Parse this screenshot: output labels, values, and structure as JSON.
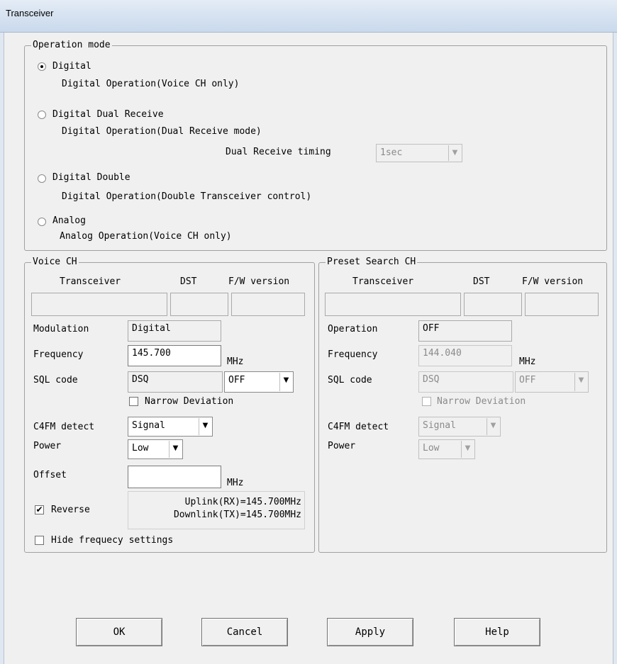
{
  "window": {
    "title": "Transceiver"
  },
  "operation_mode": {
    "group_label": "Operation mode",
    "digital": {
      "label": "Digital",
      "desc": "Digital Operation(Voice CH only)",
      "selected": true
    },
    "dual_receive": {
      "label": "Digital Dual Receive",
      "desc": "Digital Operation(Dual Receive mode)",
      "timing_label": "Dual Receive timing",
      "timing_value": "1sec",
      "selected": false
    },
    "double": {
      "label": "Digital Double",
      "desc": "Digital Operation(Double Transceiver control)",
      "selected": false
    },
    "analog": {
      "label": "Analog",
      "desc": "Analog Operation(Voice CH only)",
      "selected": false
    }
  },
  "voice_ch": {
    "group_label": "Voice CH",
    "col_transceiver": "Transceiver",
    "col_dst": "DST",
    "col_fw": "F/W version",
    "transceiver_value": "",
    "dst_value": "",
    "fw_value": "",
    "modulation_label": "Modulation",
    "modulation_value": "Digital",
    "frequency_label": "Frequency",
    "frequency_value": "145.700",
    "frequency_unit": "MHz",
    "sql_label": "SQL code",
    "sql_code_value": "DSQ",
    "sql_select_value": "OFF",
    "narrow_label": "Narrow Deviation",
    "narrow_checked": false,
    "c4fm_label": "C4FM detect",
    "c4fm_value": "Signal",
    "power_label": "Power",
    "power_value": "Low",
    "offset_label": "Offset",
    "offset_value": "",
    "offset_unit": "MHz",
    "reverse_label": "Reverse",
    "reverse_checked": true,
    "uplink": "Uplink(RX)=145.700MHz",
    "downlink": "Downlink(TX)=145.700MHz",
    "hide_label": "Hide frequecy settings",
    "hide_checked": false
  },
  "preset_ch": {
    "group_label": "Preset Search CH",
    "col_transceiver": "Transceiver",
    "col_dst": "DST",
    "col_fw": "F/W version",
    "transceiver_value": "",
    "dst_value": "",
    "fw_value": "",
    "operation_label": "Operation",
    "operation_value": "OFF",
    "frequency_label": "Frequency",
    "frequency_value": "144.040",
    "frequency_unit": "MHz",
    "sql_label": "SQL code",
    "sql_code_value": "DSQ",
    "sql_select_value": "OFF",
    "narrow_label": "Narrow Deviation",
    "c4fm_label": "C4FM detect",
    "c4fm_value": "Signal",
    "power_label": "Power",
    "power_value": "Low"
  },
  "buttons": {
    "ok": "OK",
    "cancel": "Cancel",
    "apply": "Apply",
    "help": "Help"
  }
}
